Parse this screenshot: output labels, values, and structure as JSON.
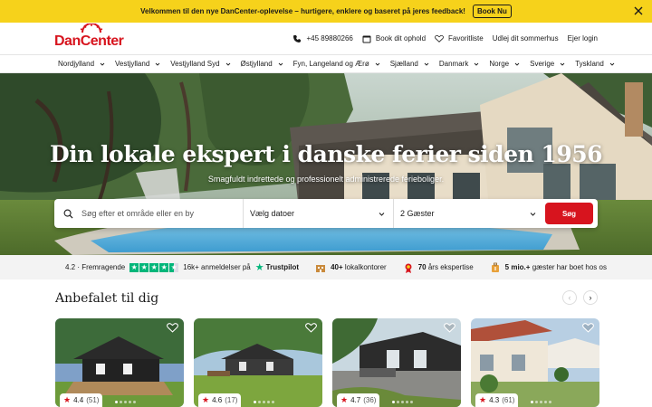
{
  "announcement": {
    "text": "Velkommen til den nye DanCenter-oplevelse – hurtigere, enklere og baseret på jeres feedback!",
    "button": "Book Nu"
  },
  "logo": {
    "text": "DanCenter"
  },
  "header": {
    "phone": "+45 89880266",
    "book_stay": "Book dit ophold",
    "favorites": "Favoritliste",
    "rent_out": "Udlej dit sommerhus",
    "owner_login": "Ejer login"
  },
  "nav": [
    "Nordjylland",
    "Vestjylland",
    "Vestjylland Syd",
    "Østjylland",
    "Fyn, Langeland og Ærø",
    "Sjælland",
    "Danmark",
    "Norge",
    "Sverige",
    "Tyskland"
  ],
  "hero": {
    "title": "Din lokale ekspert i danske ferier siden 1956",
    "subtitle": "Smagfuldt indrettede og professionelt administrerede ferieboliger."
  },
  "search": {
    "placeholder": "Søg efter et område eller en by",
    "dates": "Vælg datoer",
    "guests": "2 Gæster",
    "button": "Søg"
  },
  "trust": {
    "score": "4.2 · Fremragende",
    "reviews": "16k+ anmeldelser på",
    "trustpilot": "Trustpilot",
    "offices_bold": "40+",
    "offices": "lokalkontorer",
    "years_bold": "70",
    "years": "års ekspertise",
    "guests_bold": "5 mio.+",
    "guests": "gæster har boet hos os"
  },
  "recommended": {
    "title": "Anbefalet til dig",
    "cards": [
      {
        "rating": "4.4",
        "count": "(51)"
      },
      {
        "rating": "4.6",
        "count": "(17)"
      },
      {
        "rating": "4.7",
        "count": "(36)"
      },
      {
        "rating": "4.3",
        "count": "(61)"
      }
    ]
  },
  "colors": {
    "brand_red": "#d7141e",
    "banner_yellow": "#f6d21b",
    "trustpilot_green": "#00b67a"
  }
}
